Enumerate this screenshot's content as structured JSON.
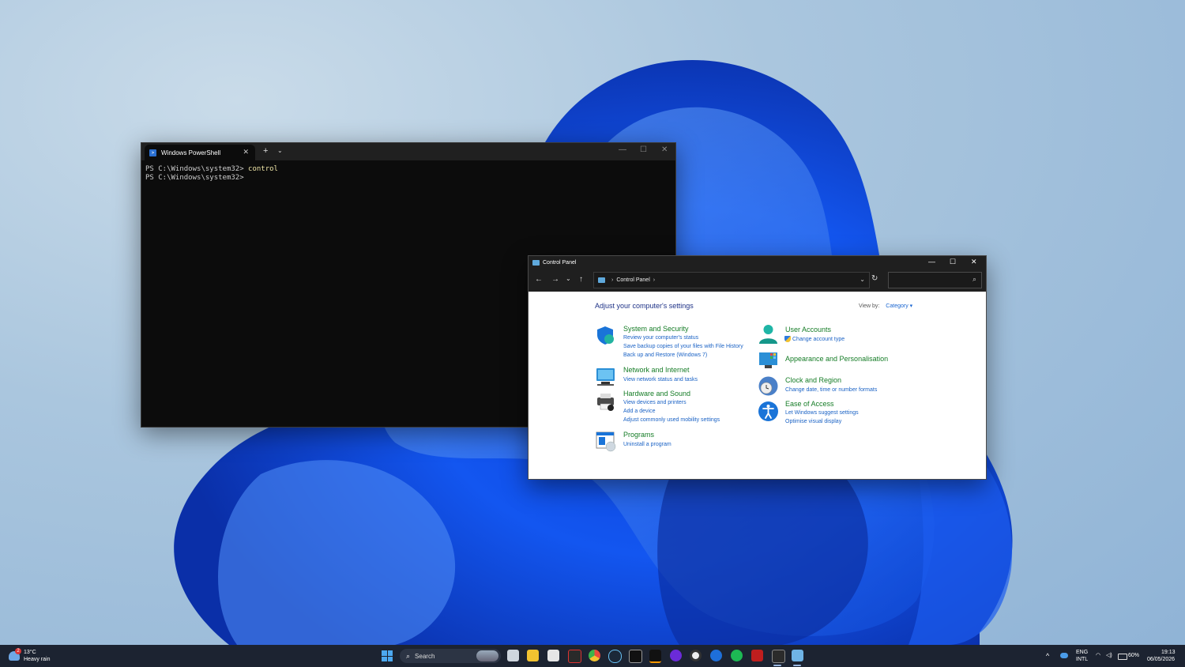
{
  "terminal": {
    "tab_title": "Windows PowerShell",
    "tab_close": "✕",
    "new_tab": "+",
    "dropdown": "⌄",
    "minimize": "—",
    "maximize": "☐",
    "close": "✕",
    "line1_prompt": "PS C:\\Windows\\system32> ",
    "line1_cmd": "control",
    "line2_prompt": "PS C:\\Windows\\system32>"
  },
  "control_panel": {
    "window_title": "Control Panel",
    "minimize": "—",
    "maximize": "☐",
    "close": "✕",
    "nav": {
      "back": "←",
      "forward": "→",
      "recent": "⌄",
      "up": "↑",
      "refresh": "↻"
    },
    "address": {
      "separator": "›",
      "location": "Control Panel",
      "trailing": "›",
      "dropdown": "⌄"
    },
    "search_icon": "⌕",
    "heading": "Adjust your computer's settings",
    "view_by_label": "View by:",
    "view_by_value": "Category ▾",
    "categories": [
      {
        "title": "System and Security",
        "icon": "shield-icon",
        "links": [
          "Review your computer's status",
          "Save backup copies of your files with File History",
          "Back up and Restore (Windows 7)"
        ]
      },
      {
        "title": "Network and Internet",
        "icon": "network-icon",
        "links": [
          "View network status and tasks"
        ]
      },
      {
        "title": "Hardware and Sound",
        "icon": "printer-icon",
        "links": [
          "View devices and printers",
          "Add a device",
          "Adjust commonly used mobility settings"
        ]
      },
      {
        "title": "Programs",
        "icon": "programs-icon",
        "links": [
          "Uninstall a program"
        ]
      },
      {
        "title": "User Accounts",
        "icon": "user-icon",
        "links": [
          "Change account type"
        ]
      },
      {
        "title": "Appearance and Personalisation",
        "icon": "monitor-icon",
        "links": []
      },
      {
        "title": "Clock and Region",
        "icon": "clock-icon",
        "links": [
          "Change date, time or number formats"
        ]
      },
      {
        "title": "Ease of Access",
        "icon": "accessibility-icon",
        "links": [
          "Let Windows suggest settings",
          "Optimise visual display"
        ]
      }
    ]
  },
  "taskbar": {
    "weather_temp": "13°C",
    "weather_desc": "Heavy rain",
    "weather_badge": "2",
    "search_label": "Search",
    "lang_top": "ENG",
    "lang_bottom": "INTL",
    "battery": "60%",
    "time": "19:13",
    "date": "06/05/2026",
    "overflow": "^",
    "pinned": [
      "start-icon",
      "file-explorer-icon",
      "folder-icon",
      "store-icon",
      "media-icon",
      "chrome-icon",
      "steam-icon",
      "epic-icon",
      "amazon-icon",
      "circle-app-icon",
      "obs-icon",
      "remote-icon",
      "spotify-icon",
      "filezilla-icon",
      "terminal-icon",
      "control-panel-icon"
    ],
    "colors": {
      "bar": "#1c2331",
      "accent": "#0078d4"
    }
  }
}
